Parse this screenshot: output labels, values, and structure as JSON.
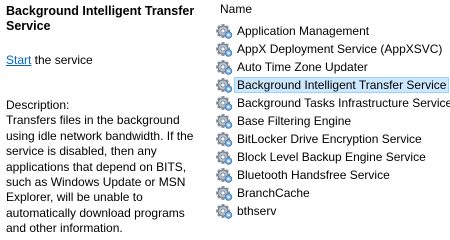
{
  "detail": {
    "title": "Background Intelligent Transfer Service",
    "start_link": "Start",
    "start_suffix": " the service",
    "description_label": "Description:",
    "description": "Transfers files in the background using idle network bandwidth. If the service is disabled, then any applications that depend on BITS, such as Windows Update or MSN Explorer, will be unable to automatically download programs and other information."
  },
  "list": {
    "header": "Name",
    "rows": [
      {
        "label": "Application Management",
        "icon": "service-gear-icon"
      },
      {
        "label": "AppX Deployment Service (AppXSVC)",
        "icon": "service-gear-icon"
      },
      {
        "label": "Auto Time Zone Updater",
        "icon": "service-gear-icon"
      },
      {
        "label": "Background Intelligent Transfer Service",
        "icon": "service-gear-icon",
        "selected": true
      },
      {
        "label": "Background Tasks Infrastructure Service",
        "icon": "service-gear-icon"
      },
      {
        "label": "Base Filtering Engine",
        "icon": "service-gear-icon"
      },
      {
        "label": "BitLocker Drive Encryption Service",
        "icon": "service-gear-icon"
      },
      {
        "label": "Block Level Backup Engine Service",
        "icon": "service-gear-icon"
      },
      {
        "label": "Bluetooth Handsfree Service",
        "icon": "service-gear-icon"
      },
      {
        "label": "BranchCache",
        "icon": "service-gear-icon"
      },
      {
        "label": "bthserv",
        "icon": "service-gear-icon"
      }
    ],
    "selection_color": "#cce8ff"
  }
}
